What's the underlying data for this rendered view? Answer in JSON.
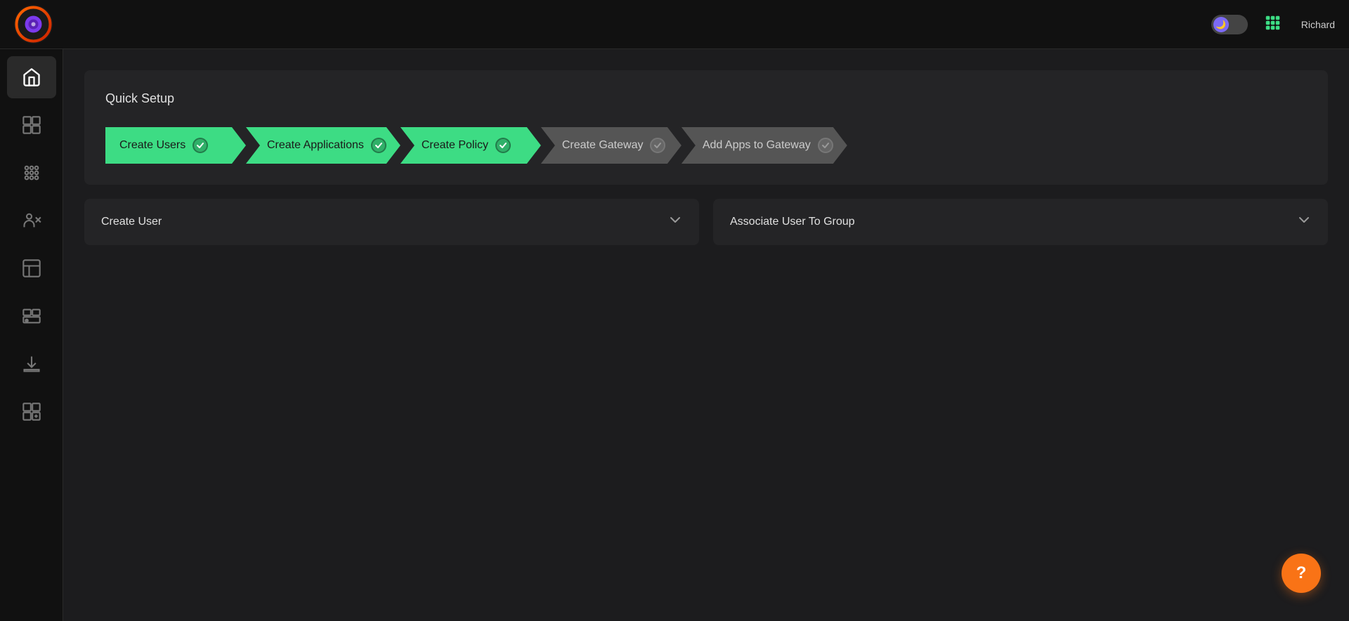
{
  "topbar": {
    "user_name": "Richard",
    "theme_icon": "🌙",
    "grid_icon": "⊞"
  },
  "sidebar": {
    "items": [
      {
        "id": "home",
        "icon": "home",
        "active": true
      },
      {
        "id": "users",
        "icon": "users",
        "active": false
      },
      {
        "id": "grid",
        "icon": "grid",
        "active": false
      },
      {
        "id": "user-config",
        "icon": "user-config",
        "active": false
      },
      {
        "id": "layout",
        "icon": "layout",
        "active": false
      },
      {
        "id": "service-config",
        "icon": "service-config",
        "active": false
      },
      {
        "id": "download",
        "icon": "download",
        "active": false
      },
      {
        "id": "add-widget",
        "icon": "add-widget",
        "active": false
      }
    ]
  },
  "quick_setup": {
    "title": "Quick Setup",
    "steps": [
      {
        "id": "create-users",
        "label": "Create Users",
        "status": "completed"
      },
      {
        "id": "create-applications",
        "label": "Create Applications",
        "status": "completed"
      },
      {
        "id": "create-policy",
        "label": "Create Policy",
        "status": "completed"
      },
      {
        "id": "create-gateway",
        "label": "Create Gateway",
        "status": "inactive"
      },
      {
        "id": "add-apps-to-gateway",
        "label": "Add Apps to Gateway",
        "status": "inactive"
      }
    ]
  },
  "cards": [
    {
      "id": "create-user",
      "title": "Create User"
    },
    {
      "id": "associate-user-to-group",
      "title": "Associate User To Group"
    }
  ],
  "help_button": {
    "label": "?"
  }
}
